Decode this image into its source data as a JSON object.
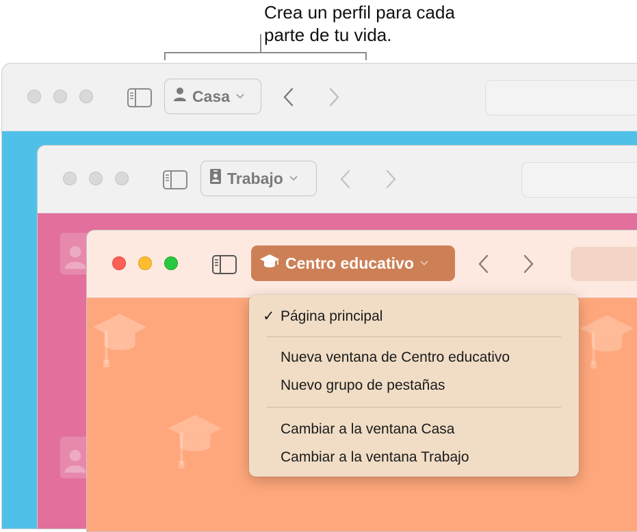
{
  "callout": {
    "text": "Crea un perfil para cada\nparte de tu vida."
  },
  "windows": {
    "casa": {
      "profile_label": "Casa",
      "profile_icon": "person-icon",
      "accent": "#4fc1e9"
    },
    "trabajo": {
      "profile_label": "Trabajo",
      "profile_icon": "id-badge-icon",
      "accent": "#e26f9c"
    },
    "centro_educativo": {
      "profile_label": "Centro educativo",
      "profile_icon": "graduation-cap-icon",
      "accent": "#ffa77c",
      "button_color": "#cd8056"
    }
  },
  "profile_menu": {
    "sections": [
      [
        {
          "label": "Página principal",
          "checked": true,
          "check": "✓"
        }
      ],
      [
        {
          "label": "Nueva ventana de Centro educativo"
        },
        {
          "label": "Nuevo grupo de pestañas"
        }
      ],
      [
        {
          "label": "Cambiar a la ventana Casa"
        },
        {
          "label": "Cambiar a la ventana Trabajo"
        }
      ]
    ]
  }
}
